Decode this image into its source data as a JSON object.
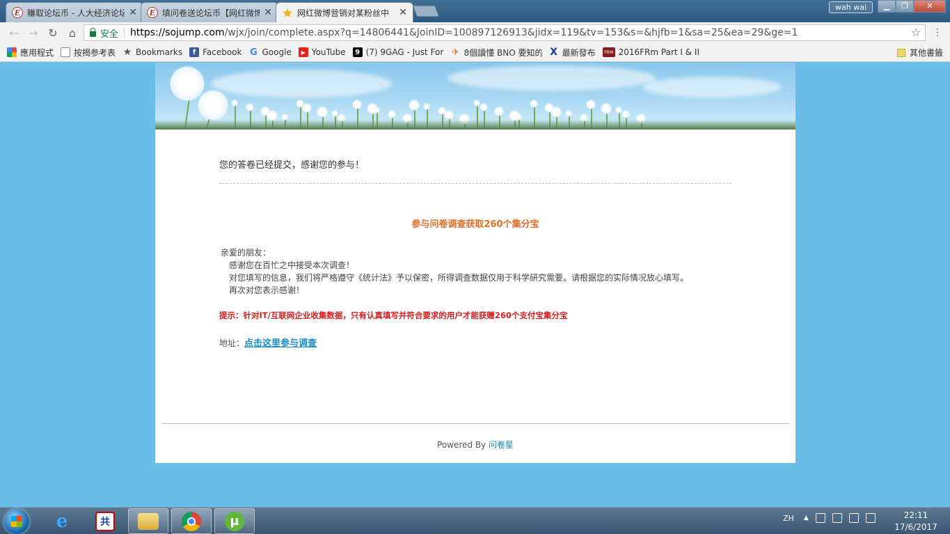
{
  "browser": {
    "tabs": [
      {
        "title": "賺取论坛币 - 人大经济论坛",
        "icon": "E"
      },
      {
        "title": "填问卷送论坛币【网红微博",
        "icon": "E"
      },
      {
        "title": "网红微博营销对某粉丝中",
        "icon": "★"
      }
    ],
    "user_badge": "wah wai",
    "secure_label": "安全",
    "url_host": "https://sojump.com",
    "url_path": "/wjx/join/complete.aspx?q=14806441&JoinID=100897126913&jidx=119&tv=153&s=&hjfb=1&sa=25&ea=29&ge=1",
    "bookmarks": [
      {
        "label": "應用程式",
        "icon": "apps-icon",
        "color": "#e04a3f"
      },
      {
        "label": "按揭参考表",
        "icon": "page-icon",
        "color": "#ffffff"
      },
      {
        "label": "Bookmarks",
        "icon": "star-icon",
        "color": "#555555"
      },
      {
        "label": "Facebook",
        "icon": "facebook-icon",
        "color": "#3b5998"
      },
      {
        "label": "Google",
        "icon": "google-icon",
        "color": "#4285f4"
      },
      {
        "label": "YouTube",
        "icon": "youtube-icon",
        "color": "#e62117"
      },
      {
        "label": "(7) 9GAG - Just For F",
        "icon": "9gag-icon",
        "color": "#000000"
      },
      {
        "label": "8個讀懂 BNO 要知的",
        "icon": "plane-icon",
        "color": "#e8732a"
      },
      {
        "label": "最新發布",
        "icon": "x-icon",
        "color": "#1f3a93"
      },
      {
        "label": "2016FRm Part I & II",
        "icon": "frm-icon",
        "color": "#8b1c1c"
      }
    ],
    "other_bookmarks": "其他書籤"
  },
  "page": {
    "thanks": "您的答卷已经提交，感谢您的参与！",
    "promo_title": "参与问卷调查获取260个集分宝",
    "greeting": "亲爱的朋友：",
    "line1": "感谢您在百忙之中接受本次调查！",
    "line2": "对您填写的信息，我们将严格遵守《统计法》予以保密，所得调查数据仅用于科学研究需要。请根据您的实际情况放心填写。",
    "line3": "再次对您表示感谢！",
    "tip": "提示：针对IT/互联网企业收集数据，只有认真填写并符合要求的用户才能获赠260个支付宝集分宝",
    "address_label": "地址：",
    "address_link": "点击这里参与调查",
    "powered_by": "Powered By",
    "powered_link": "问卷星"
  },
  "taskbar": {
    "tray_lang": "ZH",
    "time": "22:11",
    "date": "17/6/2017"
  }
}
